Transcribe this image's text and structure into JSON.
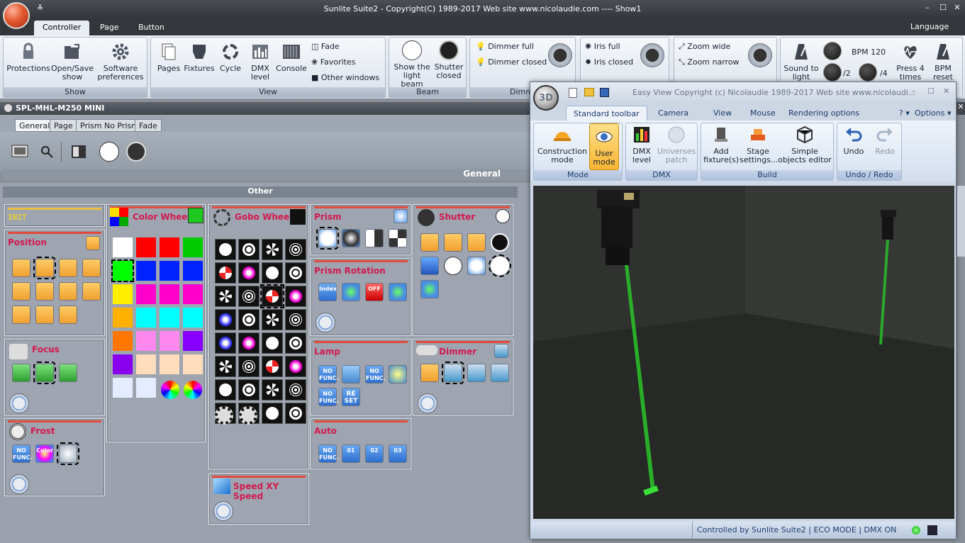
{
  "window": {
    "title": "Sunlite Suite2 - Copyright(C) 1989-2017    Web site www.nicolaudie.com ---- Show1",
    "qat_symbol": "≚",
    "controls": {
      "minimize": "–",
      "maximize": "☐",
      "close": "✕"
    }
  },
  "ribbon": {
    "tabs": [
      "Controller",
      "Page",
      "Button"
    ],
    "language": "Language",
    "groups": {
      "show": {
        "caption": "Show",
        "buttons": [
          "Protections",
          "Open/Save show",
          "Software preferences"
        ]
      },
      "view": {
        "caption": "View",
        "buttons": [
          "Pages",
          "Fixtures",
          "Cycle",
          "DMX level",
          "Console"
        ],
        "small": [
          "Fade",
          "Favorites",
          "Other windows"
        ]
      },
      "beam": {
        "caption": "Beam",
        "buttons": [
          "Show the light beam",
          "Shutter closed"
        ]
      },
      "dimmer": {
        "caption": "Dimm",
        "small": [
          "Dimmer full",
          "Dimmer closed"
        ]
      },
      "iris": {
        "small": [
          "Iris full",
          "Iris closed"
        ]
      },
      "zoom": {
        "small": [
          "Zoom wide",
          "Zoom narrow"
        ]
      },
      "bpm": {
        "sound": "Sound to light",
        "div2": "/2",
        "div4": "/4",
        "bpm": "BPM 120",
        "press4": "Press 4 times",
        "reset": "BPM reset"
      }
    }
  },
  "fixture": {
    "name": "SPL-MHL-M250 MINI",
    "page_tabs": [
      "General",
      "Page",
      "Prism No Prism",
      "Fade"
    ],
    "general_label": "General",
    "other_label": "Other"
  },
  "panels": {
    "init": "INIT",
    "position": "Position",
    "focus": "Focus",
    "frost": "Frost",
    "color_wheel": "Color Wheel",
    "gobo_wheel": "Gobo Wheel",
    "prism": "Prism",
    "prism_rotation": "Prism Rotation",
    "lamp": "Lamp",
    "auto": "Auto",
    "shutter": "Shutter",
    "dimmer": "Dimmer",
    "speed": "Speed XY Speed"
  },
  "icon_text": {
    "no_func": "NO FUNC.",
    "index": "Index",
    "off": "OFF",
    "reset": "RE SET",
    "color": "Color",
    "auto1": "01",
    "auto2": "02",
    "auto3": "03"
  },
  "colors": {
    "swatches": [
      "#ffffff",
      "#ff0000",
      "#ff0000",
      "#00cc00",
      "#00ff00",
      "#0022ff",
      "#0022ff",
      "#0022ff",
      "#ffee00",
      "#ff00cc",
      "#ff00cc",
      "#ff00cc",
      "#ffb000",
      "#00ffff",
      "#00ffff",
      "#00ffff",
      "#ff7700",
      "#ff88ee",
      "#ff88ee",
      "#8800ff",
      "#8800ee",
      "#ffddbb",
      "#ffddbb",
      "#ffddbb",
      "#e6ecff",
      "#e6ecff"
    ],
    "accent_title": "#d4184f",
    "beam": "#29c629"
  },
  "easyview": {
    "title": "Easy View   Copyright (c) Nicolaudie 1989-2017   Web site www.nicolaudi...",
    "tabs": [
      "Standard toolbar",
      "Camera",
      "View",
      "Mouse",
      "Rendering options"
    ],
    "help": "? ▾",
    "options": "Options ▾",
    "groups": {
      "mode": {
        "caption": "Mode",
        "buttons": [
          "Construction mode",
          "User mode"
        ]
      },
      "dmx": {
        "caption": "DMX",
        "buttons": [
          "DMX level",
          "Universes patch"
        ]
      },
      "build": {
        "caption": "Build",
        "buttons": [
          "Add fixture(s)",
          "Stage settings...",
          "Simple objects editor"
        ]
      },
      "undo": {
        "caption": "Undo / Redo",
        "buttons": [
          "Undo",
          "Redo"
        ]
      }
    },
    "status": {
      "controlled": "Controlled by Sunlite Suite2",
      "eco": "ECO MODE",
      "dmx": "DMX ON"
    }
  }
}
